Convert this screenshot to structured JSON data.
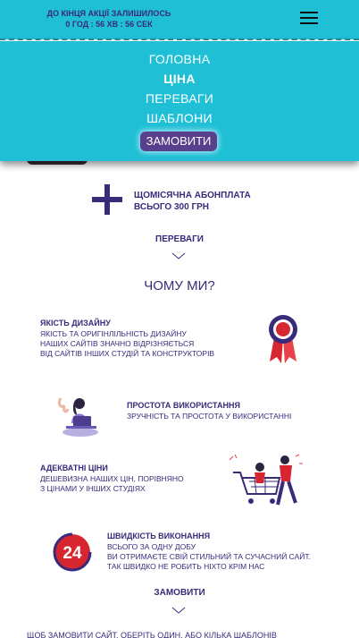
{
  "header": {
    "countdown_title": "ДО КІНЦЯ АКЦІЇ ЗАЛИШИЛОСЬ",
    "countdown_time": "0 ГОД : 56 ХВ : 56 СЕК",
    "menu_icon": "hamburger-icon"
  },
  "menu": {
    "items": [
      {
        "label": "ГОЛОВНА"
      },
      {
        "label": "ЦІНА"
      },
      {
        "label": "ПЕРЕВАГИ"
      },
      {
        "label": "ШАБЛОНИ"
      }
    ],
    "order_button": "ЗАМОВИТИ"
  },
  "subscription": {
    "line1": "ЩОМІСЯЧНА АБОНПЛАТА",
    "line2": "ВСЬОГО 300 ГРН"
  },
  "advantages_link": "ПЕРЕВАГИ",
  "why_title": "ЧОМУ МИ?",
  "features": [
    {
      "title": "ЯКІСТЬ ДИЗАЙНУ",
      "lines": [
        "ЯКІСТЬ ТА ОРИГІНЛІЛЬНІСТЬ ДИЗАЙНУ",
        "НАШИХ САЙТІВ ЗНАЧНО ВІДРІЗНЯЄТЬСЯ",
        "ВІД САЙТІВ ІНШИХ СТУДІЙ ТА КОНСТРУКТОРІВ"
      ],
      "icon": "award-ribbon-icon"
    },
    {
      "title": "ПРОСТОТА ВИКОРИСТАННЯ",
      "lines": [
        "ЗРУЧНІСТЬ ТА ПРОСТОТА У ВИКОРИСТАННІ"
      ],
      "icon": "laptop-person-icon"
    },
    {
      "title": "АДЕКВАТНІ ЦІНИ",
      "lines": [
        "ДЕШЕВИЗНА НАШИХ ЦІН, ПОРІВНЯНО",
        "З ЦІНАМИ У ІНШИХ СТУДІЯХ"
      ],
      "icon": "shopping-cart-icon"
    },
    {
      "title": "ШВИДКІСТЬ ВИКОНАННЯ",
      "lines": [
        "ВСЬОГО ЗА ОДНУ ДОБУ",
        "ВИ ОТРИМАЄТЕ СВІЙ СТИЛЬНИЙ ТА СУЧАСНИЙ САЙТ.",
        "ТАК ШВИДКО НЕ РОБИТЬ НІХТО КРІМ НАС"
      ],
      "icon": "24-hours-icon",
      "badge": "24"
    }
  ],
  "order_link": "ЗАМОВИТИ",
  "bottom_text": "ЩОБ ЗАМОВИТИ САЙТ, ОБЕРІТЬ ОДИН, АБО КІЛЬКА ШАБЛОНІВ",
  "colors": {
    "accent": "#1fbfd6",
    "brand": "#3a2a7a",
    "button": "#5a3f8c",
    "badge_red": "#d7262f"
  }
}
